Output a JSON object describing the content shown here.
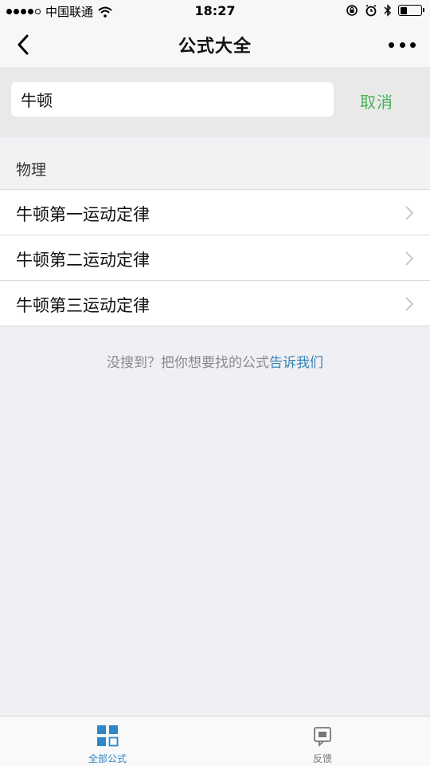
{
  "status_bar": {
    "carrier": "中国联通",
    "time": "18:27"
  },
  "nav": {
    "title": "公式大全"
  },
  "search": {
    "value": "牛顿",
    "cancel_label": "取消"
  },
  "section": {
    "title": "物理"
  },
  "results": [
    {
      "label": "牛顿第一运动定律"
    },
    {
      "label": "牛顿第二运动定律"
    },
    {
      "label": "牛顿第三运动定律"
    }
  ],
  "hint": {
    "text": "没搜到？把你想要找的公式",
    "link": "告诉我们"
  },
  "tabs": [
    {
      "label": "全部公式",
      "icon": "grid-icon",
      "active": true
    },
    {
      "label": "反馈",
      "icon": "feedback-icon",
      "active": false
    }
  ],
  "colors": {
    "accent_green": "#4cb05a",
    "link_blue": "#3a86b4",
    "tab_active": "#2f86c8"
  }
}
